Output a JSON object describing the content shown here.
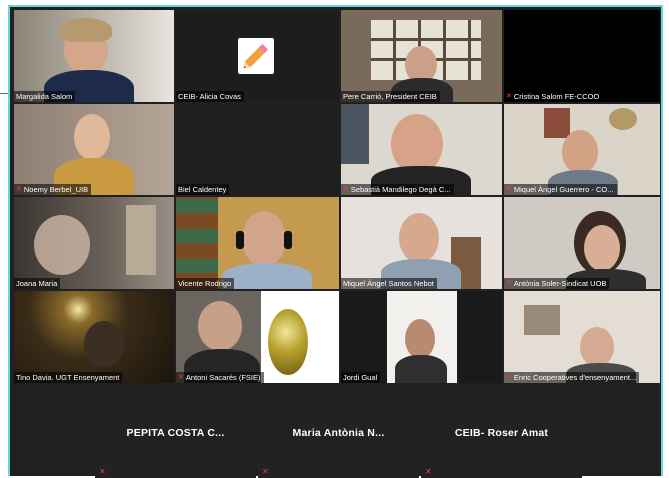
{
  "colors": {
    "frame_border": "#63d6e0",
    "active_speaker": "#c7e34a",
    "muted_icon": "#ff3b3b"
  },
  "row1": [
    {
      "name": "Margalida Salom",
      "muted": false
    },
    {
      "name": "CEIB- Alicia Covas",
      "muted": false,
      "avatar_icon": "pencil-icon"
    },
    {
      "name": "Pere Carrió, President CEIB",
      "muted": false
    },
    {
      "name": "Cristina Salom FE-CCOO",
      "muted": true
    }
  ],
  "row2": [
    {
      "name": "Noemy Berbel_UIB",
      "muted": true
    },
    {
      "name": "Biel Caldentey",
      "muted": false
    },
    {
      "name": "Sebastià Mandilego Degà C...",
      "muted": true
    },
    {
      "name": "Miquel Àngel Guerrero - CO...",
      "muted": true
    }
  ],
  "row3": [
    {
      "name": "Joana Maria",
      "muted": false
    },
    {
      "name": "Vicente Rodrigo",
      "muted": false,
      "active_speaker": true
    },
    {
      "name": "Miquel Àngel Santos Nebot",
      "muted": false
    },
    {
      "name": "Antònia Soler-Sindicat UOB",
      "muted": true
    }
  ],
  "row4": [
    {
      "name": "Tino Davia. UGT Ensenyament",
      "muted": false
    },
    {
      "name": "Antoni Sacarés (FSIE)",
      "muted": true
    },
    {
      "name": "Jordi Gual",
      "muted": false
    },
    {
      "name": "Enric Cooperatives d'ensenyament...",
      "muted": true
    }
  ],
  "row5": [
    {
      "name": "PEPITA COSTA C...",
      "muted": true
    },
    {
      "name": "Maria Antònia N...",
      "muted": true
    },
    {
      "name": "CEIB- Roser Amat",
      "muted": true
    }
  ],
  "icons": {
    "muted": "mic-muted-icon",
    "avatar": "pencil-icon"
  }
}
